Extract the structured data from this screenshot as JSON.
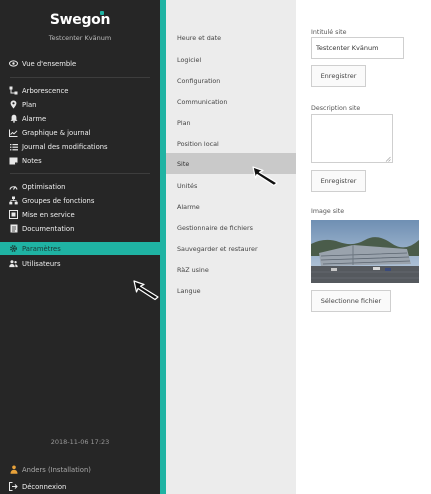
{
  "brand": {
    "name": "Swegon",
    "site_name": "Testcenter Kvänum"
  },
  "nav": {
    "items": [
      {
        "label": "Vue d'ensemble",
        "icon": "eye-icon"
      },
      {
        "label": "Arborescence",
        "icon": "tree-icon"
      },
      {
        "label": "Plan",
        "icon": "location-pin-icon"
      },
      {
        "label": "Alarme",
        "icon": "bell-icon"
      },
      {
        "label": "Graphique & journal",
        "icon": "chart-icon"
      },
      {
        "label": "Journal des modifications",
        "icon": "list-icon"
      },
      {
        "label": "Notes",
        "icon": "note-icon"
      },
      {
        "label": "Optimisation",
        "icon": "gauge-icon"
      },
      {
        "label": "Groupes de fonctions",
        "icon": "group-icon"
      },
      {
        "label": "Mise en service",
        "icon": "commissioning-icon"
      },
      {
        "label": "Documentation",
        "icon": "document-icon"
      },
      {
        "label": "Paramètres",
        "icon": "gear-icon"
      },
      {
        "label": "Utilisateurs",
        "icon": "users-icon"
      }
    ],
    "active": "Paramètres"
  },
  "footer": {
    "datetime": "2018-11-06 17:23",
    "user": "Anders (Installation)",
    "logout": "Déconnexion"
  },
  "submenu": {
    "items": [
      "Heure et date",
      "Logiciel",
      "Configuration",
      "Communication",
      "Plan",
      "Position local",
      "Site",
      "Unités",
      "Alarme",
      "Gestionnaire de fichiers",
      "Sauvegarder et restaurer",
      "RàZ usine",
      "Langue"
    ],
    "active": "Site"
  },
  "site_form": {
    "title_label": "Intitulé site",
    "title_value": "Testcenter Kvänum",
    "save_label": "Enregistrer",
    "description_label": "Description site",
    "description_value": "",
    "save2_label": "Enregistrer",
    "image_label": "Image site",
    "select_file_label": "Sélectionne fichier"
  },
  "colors": {
    "sidebar_bg": "#262626",
    "accent": "#1fb3a3",
    "submenu_bg": "#ececec",
    "submenu_active": "#c9c9c9"
  }
}
